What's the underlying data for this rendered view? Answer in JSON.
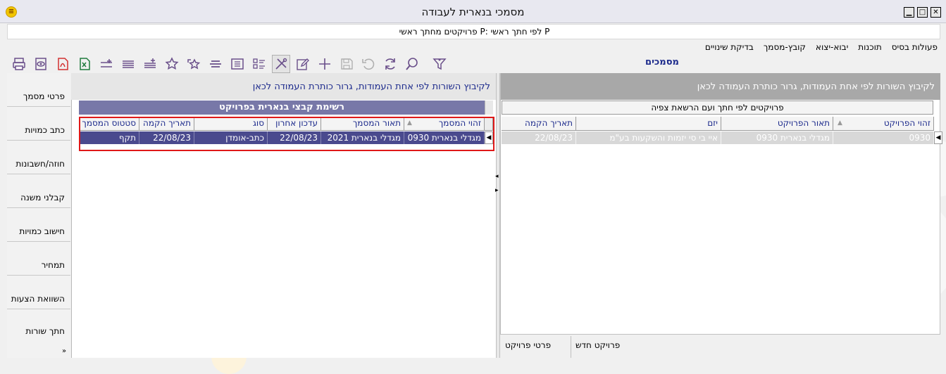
{
  "window": {
    "title": "מסמכי בנארית לעבודה",
    "subtitle": "פרויקטים מחתך ראשי P: לפי חתך ראשי P",
    "minimize": "▁",
    "maximize": "□",
    "close": "✕",
    "app_icon": "≡"
  },
  "menu": [
    {
      "label": "פעולות בסיס"
    },
    {
      "label": "תוכנות"
    },
    {
      "label": "יבוא-יצוא"
    },
    {
      "label": "קובץ-מסמך"
    },
    {
      "label": "בדיקת שינויים"
    }
  ],
  "toolbar": {
    "icons": [
      "printer-icon",
      "preview-icon",
      "pdf-icon",
      "excel-icon",
      "align-icon",
      "lines-icon",
      "lines-add-icon",
      "star-icon",
      "star-back-icon",
      "list-icon",
      "fit-icon",
      "checklist-icon",
      "tools-icon",
      "edit-icon",
      "plus-icon",
      "save-icon",
      "undo-icon",
      "refresh-icon",
      "search-icon",
      "filter-icon"
    ]
  },
  "right_panel": {
    "title": "מסמכים",
    "group_hint": "לקיבוץ השורות לפי אחת העמודות, גרור כותרת העמודה לכאן",
    "grid_title": "פרויקטים לפי חתך ועם הרשאת צפיה",
    "columns": [
      "זהוי הפרויקט",
      "תאור הפרויקט",
      "יזם",
      "תאריך הקמה"
    ],
    "rows": [
      [
        "0930",
        "מגדלי בנארית 0930",
        "איי בי סי יזמות והשקעות בע\"מ",
        "22/08/23"
      ]
    ],
    "bottom_tabs": [
      "פרויקט חדש",
      "פרטי פרויקט"
    ]
  },
  "mid_panel": {
    "group_hint": "לקיבוץ השורות לפי אחת העמודות, גרור כותרת העמודה לכאן",
    "grid_title": "רשימת קבצי בנארית בפרויקט",
    "columns": [
      "זהוי המסמך",
      "תאור המסמך",
      "עדכון אחרון",
      "סוג",
      "תאריך הקמה",
      "סטטוס המסמך"
    ],
    "rows": [
      [
        "מגדלי בנארית 0930",
        "מגדלי בנארית 2021",
        "22/08/23",
        "כתב-אומדן",
        "22/08/23",
        "תקף"
      ]
    ]
  },
  "left_tabs": [
    "פרטי מסמך",
    "כתב כמויות",
    "חוזה/חשבונות",
    "קבלני משנה",
    "חישוב כמויות",
    "תמחיר",
    "השוואת הצעות",
    "חתך שורות"
  ],
  "tabs_more": "»",
  "colors": {
    "accent_navy": "#1c2a8c",
    "selected_row": "#4a4a8e",
    "grid_title_bg": "#7878a8",
    "highlight_box": "#e01818"
  }
}
